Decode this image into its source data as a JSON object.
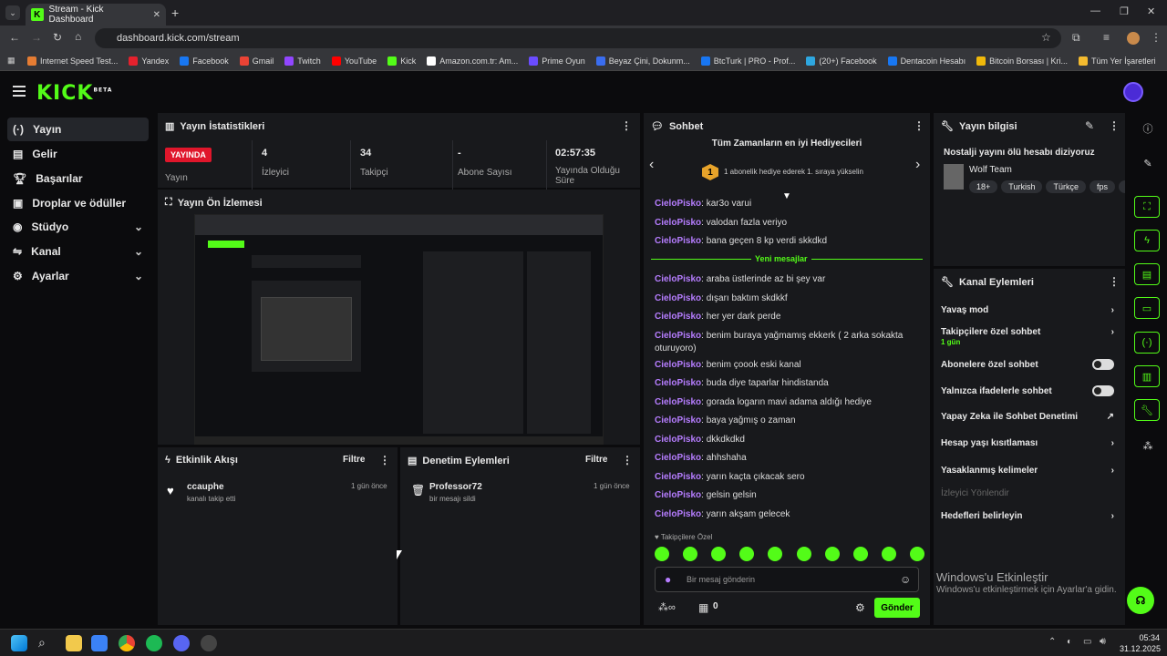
{
  "browser": {
    "tab_title": "Stream - Kick Dashboard",
    "url": "dashboard.kick.com/stream",
    "bookmarks": [
      "Internet Speed Test...",
      "Yandex",
      "Facebook",
      "Gmail",
      "Twitch",
      "YouTube",
      "Kick",
      "Amazon.com.tr: Am...",
      "Prime Oyun",
      "Beyaz Çini, Dokunm...",
      "BtcTurk | PRO - Prof...",
      "(20+) Facebook",
      "Dentacoin Hesabı",
      "Bitcoin Borsası | Kri...",
      "Tüm Yer İşaretleri"
    ],
    "bookmark_colors": [
      "#e57c33",
      "#e4212d",
      "#1877f2",
      "#ea4335",
      "#9146ff",
      "#ff0000",
      "#53fc18",
      "#ffffff",
      "#6a4cff",
      "#3a6df0",
      "#1876f2",
      "#2ea7e0",
      "#1877f2",
      "#f0b90b",
      "#f3ba2f"
    ]
  },
  "app": {
    "logo": "KICK",
    "logo_badge": "BETA"
  },
  "sidebar": {
    "items": [
      {
        "label": "Yayın",
        "icon": "broadcast-icon"
      },
      {
        "label": "Gelir",
        "icon": "revenue-icon"
      },
      {
        "label": "Başarılar",
        "icon": "trophy-icon"
      },
      {
        "label": "Droplar ve ödüller",
        "icon": "gift-icon"
      },
      {
        "label": "Stüdyo",
        "icon": "studio-icon"
      },
      {
        "label": "Kanal",
        "icon": "channel-icon"
      },
      {
        "label": "Ayarlar",
        "icon": "gear-icon"
      }
    ]
  },
  "stats": {
    "title": "Yayın İstatistikleri",
    "live_badge": "YAYINDA",
    "live_label": "Yayın",
    "viewers_value": "4",
    "viewers_label": "İzleyici",
    "followers_value": "34",
    "followers_label": "Takipçi",
    "subs_value": "-",
    "subs_label": "Abone Sayısı",
    "uptime_value": "02:57:35",
    "uptime_label": "Yayında Olduğu Süre"
  },
  "preview": {
    "title": "Yayın Ön İzlemesi"
  },
  "activity": {
    "title": "Etkinlik Akışı",
    "filter": "Filtre",
    "items": [
      {
        "user": "ccauphe",
        "detail": "kanalı takip etti",
        "time": "1 gün önce"
      }
    ]
  },
  "moderation": {
    "title": "Denetim Eylemleri",
    "filter": "Filtre",
    "items": [
      {
        "user": "Professor72",
        "detail": "bir mesajı sildi",
        "time": "1 gün önce"
      }
    ]
  },
  "chat": {
    "title": "Sohbet",
    "gifters_title": "Tüm Zamanların en iyi Hediyecileri",
    "gifters_rank": "1",
    "gifters_text": "1 abonelik hediye ederek 1. sıraya yükselin",
    "new_messages": "Yeni mesajlar",
    "messages_before": [
      {
        "user": "CieloPisko",
        "text": "kar3o varui"
      },
      {
        "user": "CieloPisko",
        "text": "valodan fazla veriyo"
      },
      {
        "user": "CieloPisko",
        "text": "bana geçen 8 kp verdi skkdkd"
      }
    ],
    "messages_after": [
      {
        "user": "CieloPisko",
        "text": "araba üstlerinde az bi şey var"
      },
      {
        "user": "CieloPisko",
        "text": "dışarı baktım skdkkf"
      },
      {
        "user": "CieloPisko",
        "text": "her yer dark perde"
      },
      {
        "user": "CieloPisko",
        "text": "benim buraya yağmamış ekkerk ( 2 arka sokakta oturuyoro)"
      },
      {
        "user": "CieloPisko",
        "text": "benim çoook eski kanal"
      },
      {
        "user": "CieloPisko",
        "text": "buda diye taparlar hindistanda"
      },
      {
        "user": "CieloPisko",
        "text": "gorada logarın mavi adama aldığı hediye"
      },
      {
        "user": "CieloPisko",
        "text": "baya yağmış o zaman"
      },
      {
        "user": "CieloPisko",
        "text": "dkkdkdkd"
      },
      {
        "user": "CieloPisko",
        "text": "ahhshaha"
      },
      {
        "user": "CieloPisko",
        "text": "yarın kaçta çıkacak sero"
      },
      {
        "user": "CieloPisko",
        "text": "gelsin gelsin"
      },
      {
        "user": "CieloPisko",
        "text": "yarın akşam gelecek"
      }
    ],
    "followers_only_label": "Takipçilere Özel",
    "input_placeholder": "Bir mesaj gönderin",
    "points_count": "0",
    "send_label": "Gönder"
  },
  "stream_info": {
    "title": "Yayın bilgisi",
    "stream_title": "Nostalji yayını ölü hesabı diziyoruz",
    "category": "Wolf Team",
    "tags": [
      "18+",
      "Turkish",
      "Türkçe",
      "fps",
      "fun"
    ]
  },
  "channel_actions": {
    "title": "Kanal Eylemleri",
    "slow_mode": "Yavaş mod",
    "followers_chat": "Takipçilere özel sohbet",
    "followers_chat_sub": "1 gün",
    "subs_chat": "Abonelere özel sohbet",
    "emote_chat": "Yalnızca ifadelerle sohbet",
    "ai_moderation": "Yapay Zeka ile Sohbet Denetimi",
    "age_restriction": "Hesap yaşı kısıtlaması",
    "banned_words": "Yasaklanmış kelimeler",
    "redirect": "İzleyici Yönlendir",
    "goals": "Hedefleri belirleyin"
  },
  "windows": {
    "activate_title": "Windows'u Etkinleştir",
    "activate_sub": "Windows'u etkinleştirmek için Ayarlar'a gidin.",
    "time": "05:34",
    "date": "31.12.2025"
  }
}
